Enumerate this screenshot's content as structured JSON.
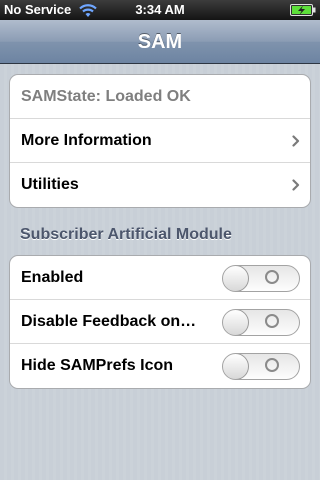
{
  "statusbar": {
    "carrier": "No Service",
    "time": "3:34 AM"
  },
  "navbar": {
    "title": "SAM"
  },
  "group1": {
    "rows": [
      {
        "label": "SAMState: Loaded OK"
      },
      {
        "label": "More Information"
      },
      {
        "label": "Utilities"
      }
    ]
  },
  "section": {
    "header": "Subscriber Artificial Module"
  },
  "group2": {
    "rows": [
      {
        "label": "Enabled",
        "value": false
      },
      {
        "label": "Disable Feedback on…",
        "value": false
      },
      {
        "label": "Hide SAMPrefs Icon",
        "value": false
      }
    ]
  },
  "colors": {
    "navbar": "#7f93ad",
    "background": "#c5ccd4",
    "section_header": "#4c566c"
  }
}
